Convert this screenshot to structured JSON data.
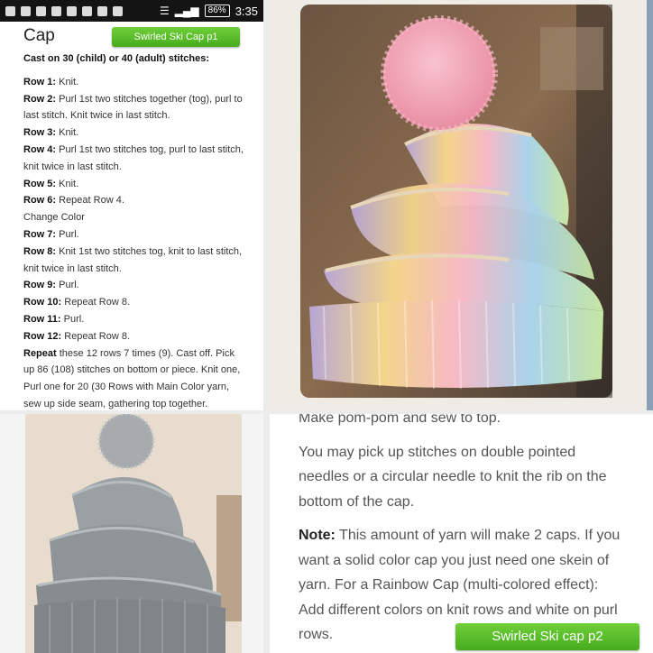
{
  "status_bar": {
    "battery": "86%",
    "time": "3:35"
  },
  "pattern": {
    "title": "Cap",
    "button_label": "Swirled Ski Cap p1",
    "cast_on": "Cast on 30 (child) or 40 (adult) stitches:",
    "rows": [
      {
        "label": "Row 1:",
        "text": " Knit."
      },
      {
        "label": "Row 2:",
        "text": " Purl 1st two stitches together (tog), purl to last stitch. Knit twice in last stitch."
      },
      {
        "label": "Row 3:",
        "text": " Knit."
      },
      {
        "label": "Row 4:",
        "text": " Purl 1st two stitches tog, purl to last stitch, knit twice in last stitch."
      },
      {
        "label": "Row 5:",
        "text": " Knit."
      },
      {
        "label": "Row 6:",
        "text": " Repeat Row 4."
      },
      {
        "label": "",
        "text": "Change Color"
      },
      {
        "label": "Row 7:",
        "text": " Purl."
      },
      {
        "label": "Row 8:",
        "text": " Knit 1st two stitches tog, knit to last stitch, knit twice in last stitch."
      },
      {
        "label": "Row 9:",
        "text": " Purl."
      },
      {
        "label": "Row 10:",
        "text": " Repeat Row 8."
      },
      {
        "label": "Row 11:",
        "text": " Purl."
      },
      {
        "label": "Row 12:",
        "text": " Repeat Row 8."
      },
      {
        "label": "Repeat",
        "text": " these 12 rows 7 times (9). Cast off. Pick up 86 (108) stitches on bottom or piece. Knit one, Purl one for 20 (30 Rows with Main Color yarn, sew up side seam, gathering top together."
      }
    ]
  },
  "instructions": {
    "pompom": "Make pom-pom and sew to top.",
    "needles": "You may pick up stitches on double pointed needles or a circular needle to knit the rib on the bottom of the cap.",
    "note_label": "Note:",
    "note_text": " This amount of yarn will make 2 caps. If you want a solid color cap you just need one skein of yarn. For a Rainbow Cap (multi-colored effect): Add different colors on knit rows and white on purl rows.",
    "button_label": "Swirled Ski cap p2"
  },
  "colors": {
    "button_green": "#52b52a",
    "pompom_pink": "#f4a3b6",
    "hat_gray": "#8f9497"
  }
}
